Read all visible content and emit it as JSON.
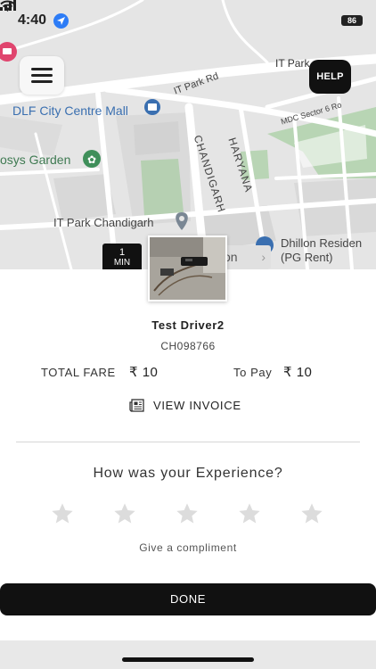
{
  "status_bar": {
    "time": "4:40",
    "battery": "86"
  },
  "map": {
    "labels": {
      "it_park_rd_1": "IT Park Rd",
      "it_park_rd_2": "IT Park",
      "dlf_mall": "DLF City Centre Mall",
      "mdc_sector": "MDC Sector 6 Ro",
      "garden": "osys Garden",
      "chandigarh": "CHANDIGARH",
      "haryana": "HARYANA",
      "it_park_chandigarh": "IT Park Chandigarh",
      "dhillon_1": "Dhillon Residen",
      "dhillon_2": "(PG Rent)"
    },
    "help_button": "HELP",
    "eta": {
      "value": "1",
      "unit": "MIN",
      "pill_text": "tion"
    }
  },
  "trip": {
    "driver_name": "Test Driver2",
    "vehicle_number": "CH098766",
    "total_fare_label": "TOTAL FARE",
    "total_fare_value": "₹ 10",
    "to_pay_label": "To Pay",
    "to_pay_value": "₹ 10",
    "invoice_label": "VIEW INVOICE"
  },
  "rating": {
    "title": "How was your Experience?",
    "stars": 5,
    "selected": 0,
    "compliment": "Give a compliment"
  },
  "actions": {
    "done": "DONE"
  },
  "colors": {
    "star_empty": "#dcdcdc",
    "button": "#111111",
    "map_background": "#e6e6e6",
    "park_green": "#b9d6b6",
    "poi_blue": "#3a6fb0"
  }
}
